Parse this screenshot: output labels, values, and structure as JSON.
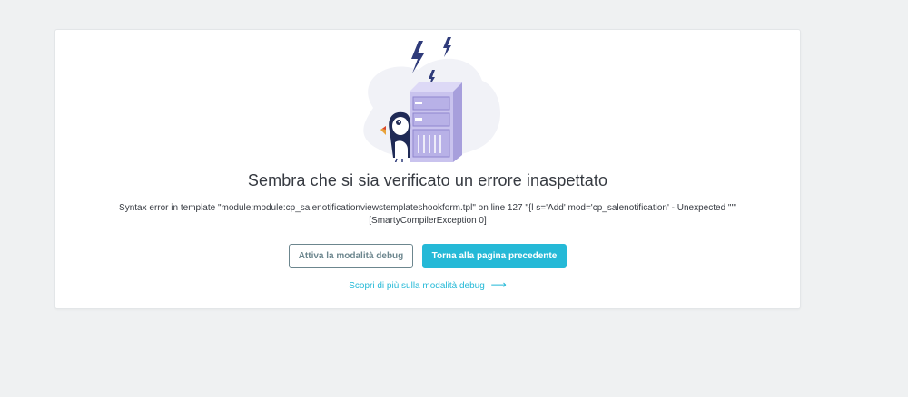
{
  "error": {
    "title": "Sembra che si sia verificato un errore inaspettato",
    "message_line1": "Syntax error in template \"module:module:cp_salenotificationviewstemplateshookform.tpl\" on line 127 \"{l s='Add' mod='cp_salenotification' - Unexpected \"'\"",
    "message_line2": "[SmartyCompilerException 0]"
  },
  "actions": {
    "debug_button": "Attiva la modalità debug",
    "back_button": "Torna alla pagina precedente",
    "learn_more_link": "Scopri di più sulla modalità debug",
    "learn_more_arrow": "⟶"
  },
  "illustration": {
    "icon": "server-error-puffin-illustration"
  },
  "colors": {
    "accent": "#25b9d7",
    "text": "#363a41",
    "outline": "#6c868e",
    "server": "#c9c3ee",
    "blob": "#f1f2f7",
    "page_bg": "#eff1f2"
  }
}
